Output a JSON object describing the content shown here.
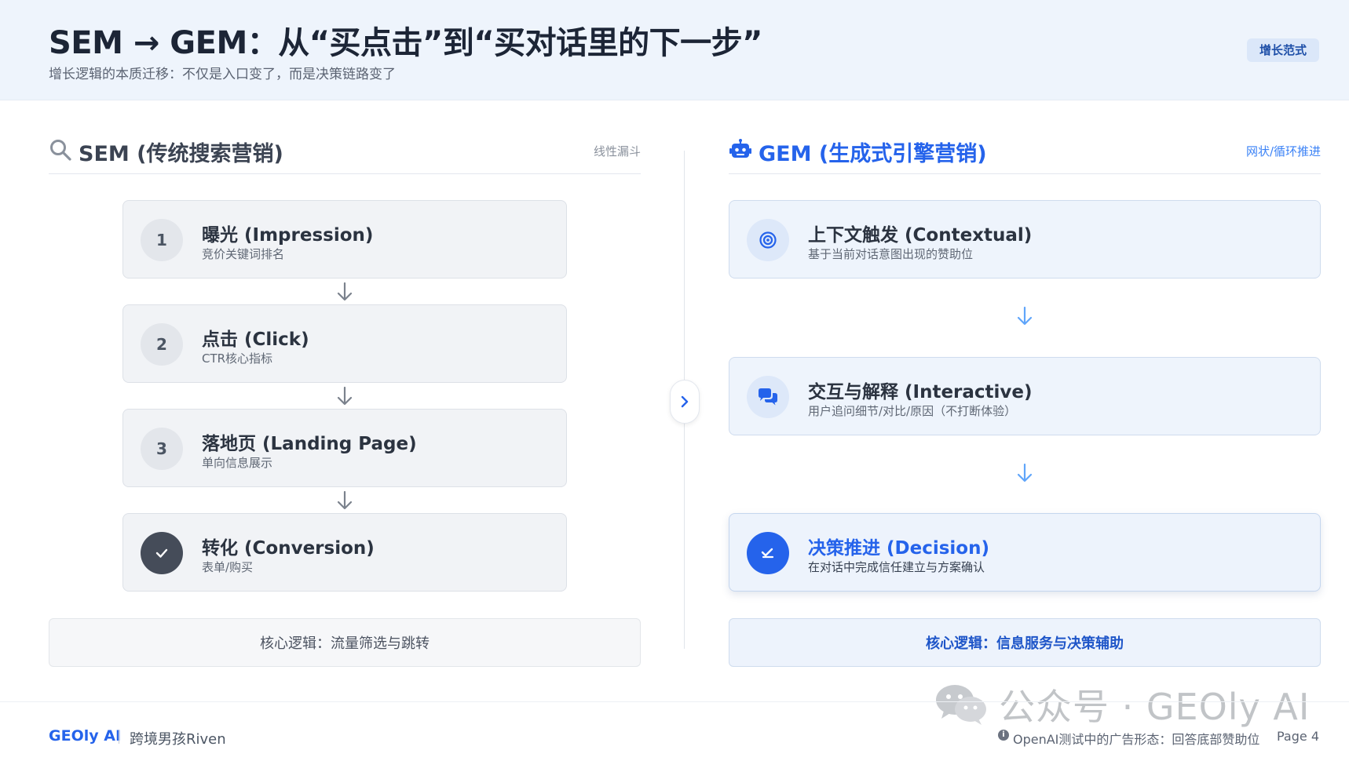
{
  "header": {
    "title": "SEM → GEM：从“买点击”到“买对话里的下一步”",
    "subtitle": "增长逻辑的本质迁移：不仅是入口变了，而是决策链路变了",
    "badge": "增长范式"
  },
  "sem": {
    "icon": "search-icon",
    "title": "SEM (传统搜索营销)",
    "tag": "线性漏斗",
    "steps": [
      {
        "badge": "1",
        "title": "曝光 (Impression)",
        "desc": "竞价关键词排名"
      },
      {
        "badge": "2",
        "title": "点击 (Click)",
        "desc": "CTR核心指标"
      },
      {
        "badge": "3",
        "title": "落地页 (Landing Page)",
        "desc": "单向信息展示"
      },
      {
        "badge_icon": "check-icon",
        "title": "转化 (Conversion)",
        "desc": "表单/购买"
      }
    ],
    "logic": "核心逻辑：流量筛选与跳转"
  },
  "gem": {
    "icon": "robot-icon",
    "title": "GEM (生成式引擎营销)",
    "tag": "网状/循环推进",
    "steps": [
      {
        "badge_icon": "target-icon",
        "title": "上下文触发 (Contextual)",
        "desc": "基于当前对话意图出现的赞助位"
      },
      {
        "badge_icon": "chat-bubbles-icon",
        "title": "交互与解释 (Interactive)",
        "desc": "用户追问细节/对比/原因（不打断体验）"
      },
      {
        "badge_icon": "check-icon",
        "title": "决策推进 (Decision)",
        "desc": "在对话中完成信任建立与方案确认"
      }
    ],
    "logic": "核心逻辑：信息服务与决策辅助"
  },
  "footer": {
    "brand": "GEOly AI",
    "author": "跨境男孩Riven",
    "note": "OpenAI测试中的广告形态：回答底部赞助位",
    "page": "Page 4"
  },
  "watermark": {
    "text": "公众号 · GEOly AI"
  },
  "colors": {
    "accent": "#2563eb",
    "header_bg": "#eef4fc",
    "sem_text": "#3b4352",
    "dark_badge": "#454c59"
  }
}
